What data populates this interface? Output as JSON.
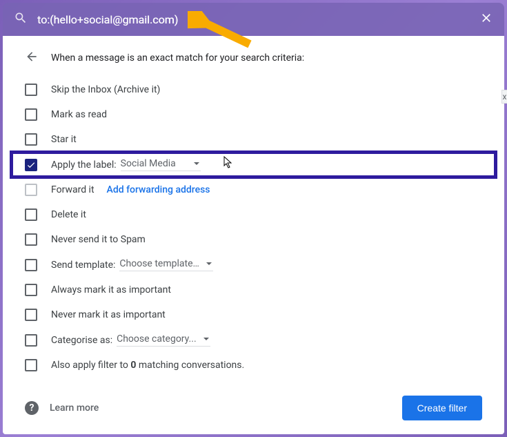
{
  "search": {
    "query": "to:(hello+social@gmail.com)"
  },
  "header": {
    "text": "When a message is an exact match for your search criteria:"
  },
  "options": {
    "skip_inbox": "Skip the Inbox (Archive it)",
    "mark_read": "Mark as read",
    "star_it": "Star it",
    "apply_label": "Apply the label:",
    "apply_label_value": "Social Media",
    "forward_it": "Forward it",
    "forward_link": "Add forwarding address",
    "delete_it": "Delete it",
    "never_spam": "Never send it to Spam",
    "send_template": "Send template:",
    "send_template_value": "Choose template…",
    "always_important": "Always mark it as important",
    "never_important": "Never mark it as important",
    "categorise": "Categorise as:",
    "categorise_value": "Choose category...",
    "also_apply_prefix": "Also apply filter to ",
    "also_apply_count": "0",
    "also_apply_suffix": " matching conversations."
  },
  "footer": {
    "learn_more": "Learn more",
    "create_filter": "Create filter"
  },
  "badge_x": "x"
}
